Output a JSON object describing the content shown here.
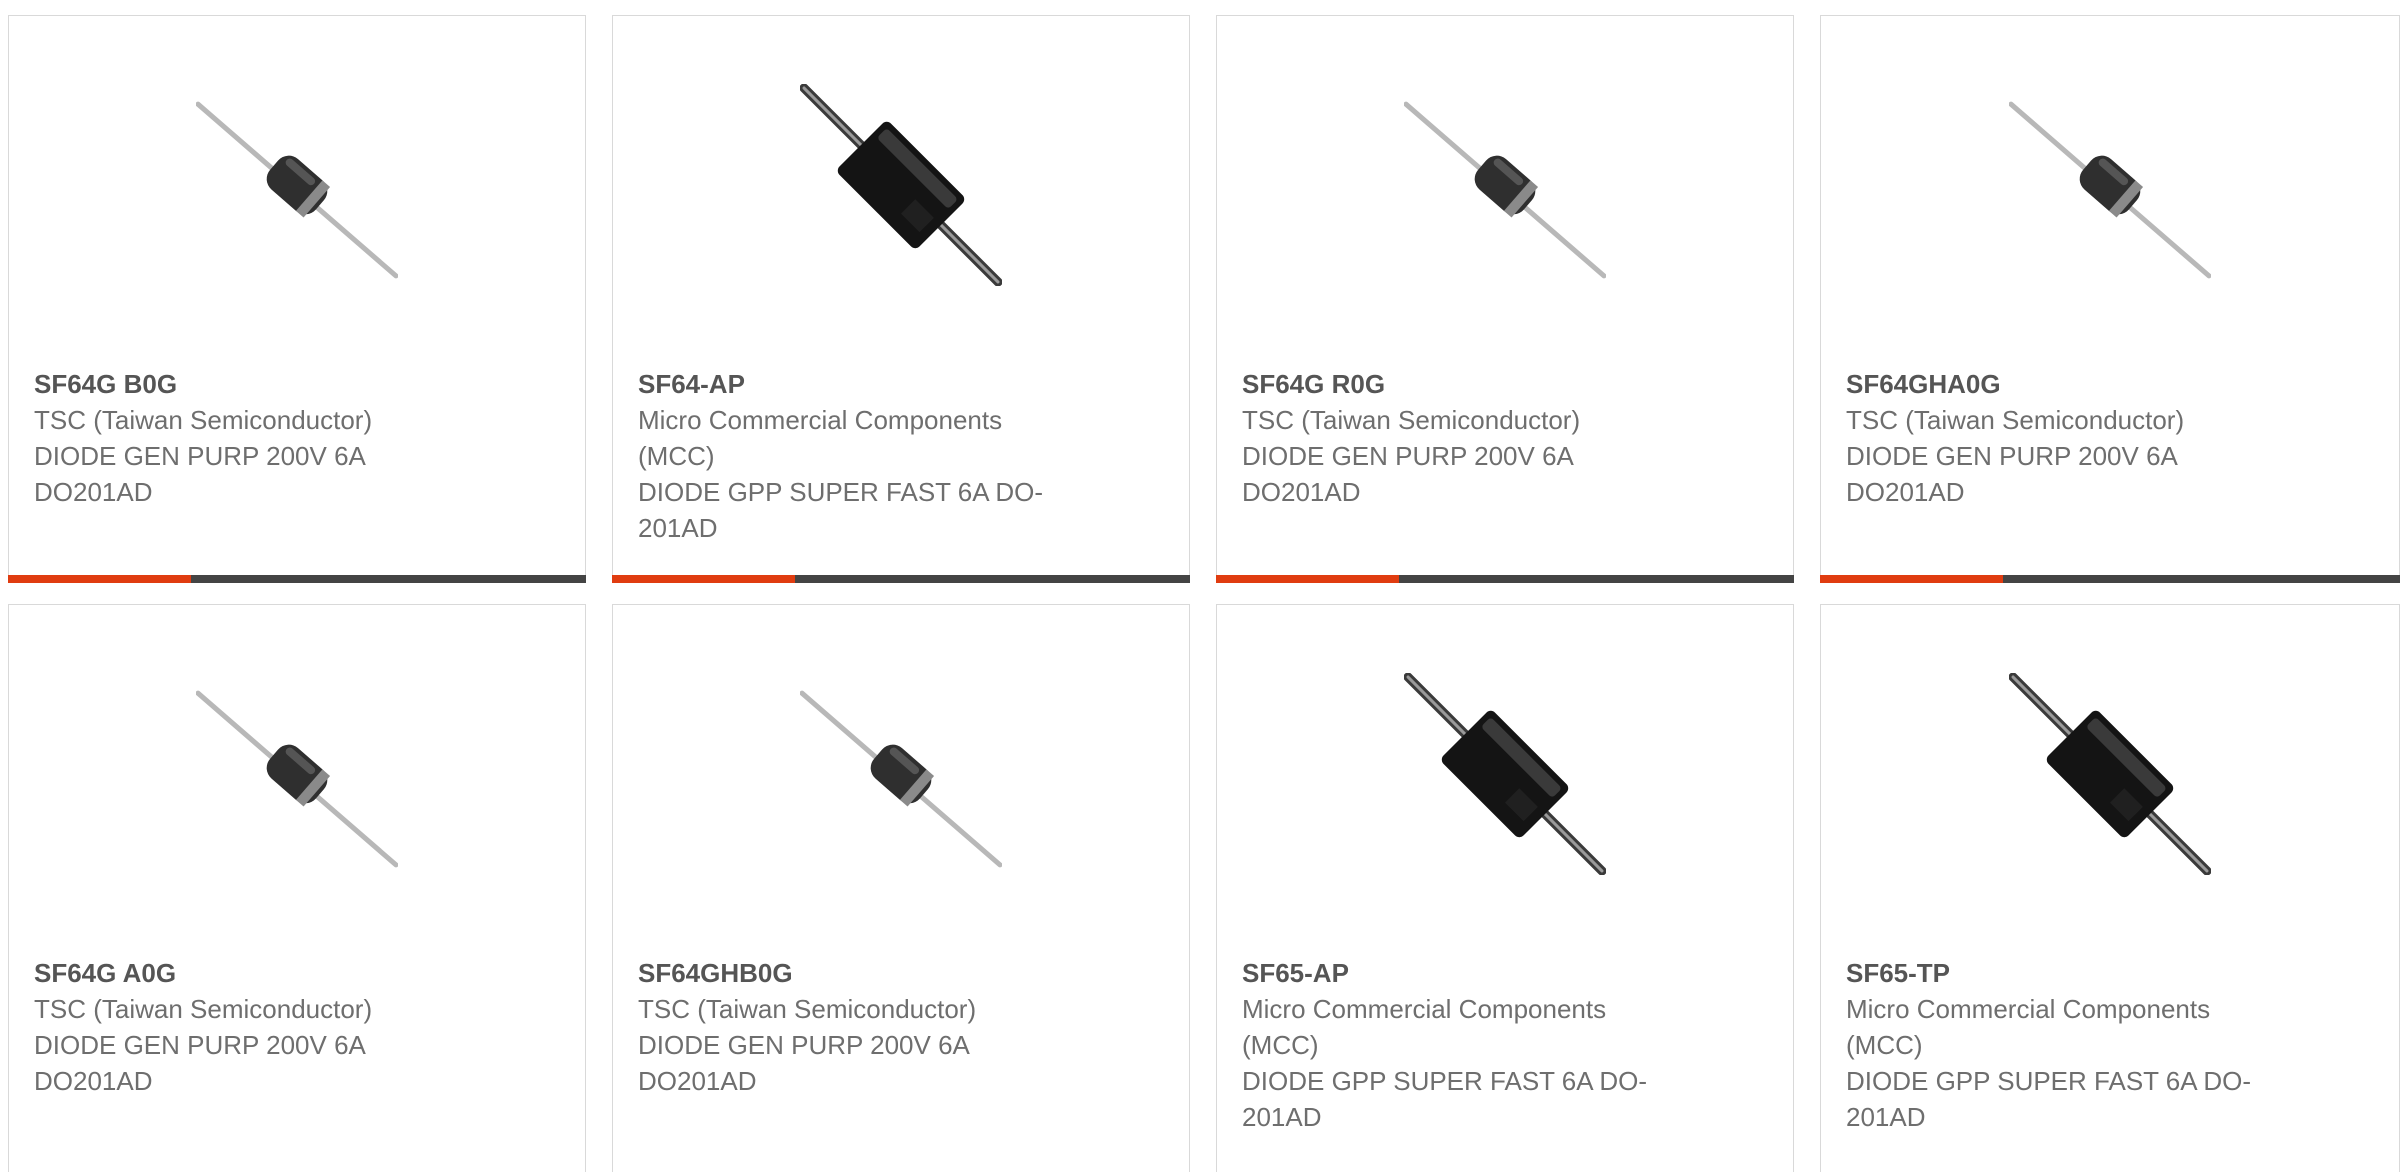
{
  "colors": {
    "accent": "#e03c10",
    "bar_dark": "#444444",
    "part_text": "#555555",
    "body_text": "#6e6e6e",
    "card_border": "#d9d9d9"
  },
  "products": [
    {
      "part": "SF64G B0G",
      "manufacturer": "TSC (Taiwan Semiconductor)",
      "description": "DIODE GEN PURP 200V 6A DO201AD",
      "image_icon": "axial-diode-small-icon"
    },
    {
      "part": "SF64-AP",
      "manufacturer": "Micro Commercial Components (MCC)",
      "description": "DIODE GPP SUPER FAST 6A DO-201AD",
      "image_icon": "axial-diode-large-icon"
    },
    {
      "part": "SF64G R0G",
      "manufacturer": "TSC (Taiwan Semiconductor)",
      "description": "DIODE GEN PURP 200V 6A DO201AD",
      "image_icon": "axial-diode-small-icon"
    },
    {
      "part": "SF64GHA0G",
      "manufacturer": "TSC (Taiwan Semiconductor)",
      "description": "DIODE GEN PURP 200V 6A DO201AD",
      "image_icon": "axial-diode-small-icon"
    },
    {
      "part": "SF64G A0G",
      "manufacturer": "TSC (Taiwan Semiconductor)",
      "description": "DIODE GEN PURP 200V 6A DO201AD",
      "image_icon": "axial-diode-small-icon"
    },
    {
      "part": "SF64GHB0G",
      "manufacturer": "TSC (Taiwan Semiconductor)",
      "description": "DIODE GEN PURP 200V 6A DO201AD",
      "image_icon": "axial-diode-small-icon"
    },
    {
      "part": "SF65-AP",
      "manufacturer": "Micro Commercial Components (MCC)",
      "description": "DIODE GPP SUPER FAST 6A DO-201AD",
      "image_icon": "axial-diode-large-icon"
    },
    {
      "part": "SF65-TP",
      "manufacturer": "Micro Commercial Components (MCC)",
      "description": "DIODE GPP SUPER FAST 6A DO-201AD",
      "image_icon": "axial-diode-large-icon"
    }
  ]
}
